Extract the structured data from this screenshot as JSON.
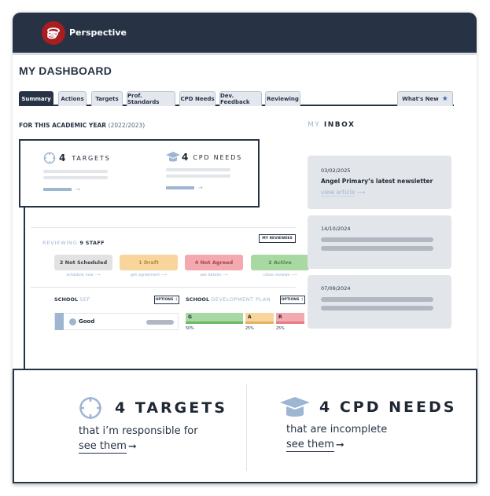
{
  "app": {
    "brand": "Perspective"
  },
  "page": {
    "title": "MY DASHBOARD"
  },
  "tabs": [
    {
      "label": "Summary",
      "active": true
    },
    {
      "label": "Actions"
    },
    {
      "label": "Targets"
    },
    {
      "label": "Prof. Standards"
    },
    {
      "label": "CPD Needs"
    },
    {
      "label": "Dev. Feedback"
    },
    {
      "label": "Reviewing"
    }
  ],
  "whats_new": {
    "label": "What's New",
    "icon": "star-icon"
  },
  "academic_year": {
    "label": "FOR THIS ACADEMIC YEAR",
    "value": "(2022/2023)"
  },
  "summary": {
    "targets": {
      "count": "4",
      "label": "TARGETS",
      "icon": "crosshair-icon"
    },
    "cpd": {
      "count": "4",
      "label": "CPD NEEDS",
      "icon": "graduation-cap-icon"
    }
  },
  "reviewing": {
    "label": "REVIEWING",
    "count_label": "9 STAFF",
    "my_reviewees": "MY REVIEWEES",
    "statuses": [
      {
        "label": "2 Not Scheduled",
        "link": "schedule now ⟶",
        "bg": "#e2e2e2",
        "fg": "#3a3f47"
      },
      {
        "label": "1 Draft",
        "link": "get agreement ⟶",
        "bg": "#f8d59b",
        "fg": "#b58a40"
      },
      {
        "label": "4 Not Agreed",
        "link": "see details ⟶",
        "bg": "#f4a9ae",
        "fg": "#9c4a52"
      },
      {
        "label": "2 Active",
        "link": "close reviews ⟶",
        "bg": "#a9d9a3",
        "fg": "#4b8a45"
      }
    ]
  },
  "sef": {
    "title_bold": "SCHOOL",
    "title_light": "SEF",
    "options": "OPTIONS ⋮",
    "rating": "Good"
  },
  "sdp": {
    "title_bold": "SCHOOL",
    "title_light": "DEVELOPMENT PLAN",
    "options": "OPTIONS ⋮",
    "rag": [
      {
        "label": "G",
        "percent": "50%",
        "share": 0.5,
        "bg": "#a9d9a3",
        "edge": "#6cb865"
      },
      {
        "label": "A",
        "percent": "25%",
        "share": 0.25,
        "bg": "#f8d59b",
        "edge": "#e3b160"
      },
      {
        "label": "R",
        "percent": "25%",
        "share": 0.25,
        "bg": "#f4a9ae",
        "edge": "#e27d85"
      }
    ]
  },
  "inbox": {
    "title_light": "MY",
    "title_bold": "INBOX",
    "items": [
      {
        "date": "03/02/2025",
        "title": "Angel Primary’s latest newsletter",
        "link": "view article"
      },
      {
        "date": "14/10/2024"
      },
      {
        "date": "07/09/2024"
      }
    ]
  },
  "callout": {
    "targets": {
      "heading": "4 TARGETS",
      "sub": "that i’m responsible for",
      "link": "see them"
    },
    "cpd": {
      "heading": "4 CPD NEEDS",
      "sub": "that are incomplete",
      "link": "see them"
    }
  }
}
